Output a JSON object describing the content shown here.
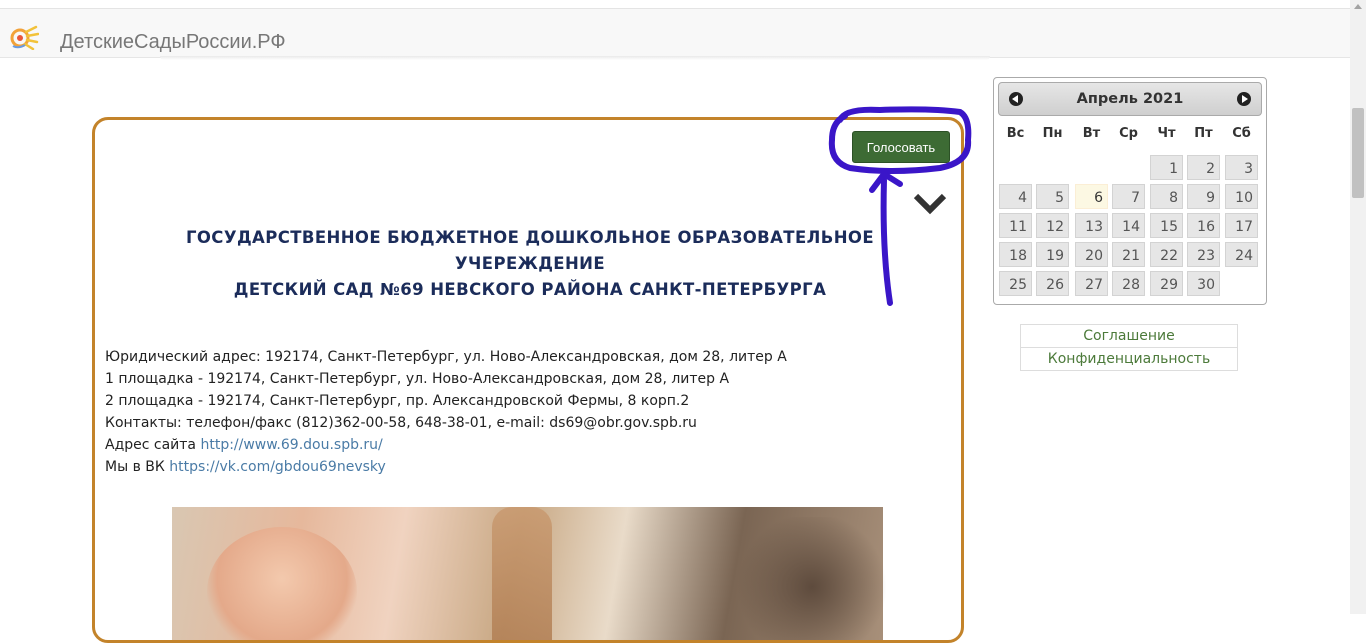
{
  "site": {
    "brand": "ДетскиеСадыРоссии.РФ",
    "logo_icon": "sun-hand-logo"
  },
  "card": {
    "vote_label": "Голосовать",
    "title_lines": [
      "ГОСУДАРСТВЕННОЕ БЮДЖЕТНОЕ ДОШКОЛЬНОЕ ОБРАЗОВАТЕЛЬНОЕ",
      "УЧЕРЕЖДЕНИЕ",
      "ДЕТСКИЙ САД №69 НЕВСКОГО РАЙОНА САНКТ-ПЕТЕРБУРГА"
    ],
    "info": {
      "legal_address": "Юридический адрес: 192174, Санкт-Петербург, ул. Ново-Александровская, дом 28, литер А",
      "site1": "1 площадка - 192174, Санкт-Петербург, ул. Ново-Александровская, дом 28, литер А",
      "site2": "2 площадка - 192174, Санкт-Петербург, пр. Александровской Фермы, 8 корп.2",
      "contacts": "Контакты: телефон/факс  (812)362-00-58, 648-38-01, e-mail: ds69@obr.gov.spb.ru",
      "website_label": "Адрес сайта ",
      "website_url": "http://www.69.dou.spb.ru/",
      "vk_label": "Мы в ВК ",
      "vk_url": "https://vk.com/gbdou69nevsky"
    }
  },
  "calendar": {
    "month_title": "Апрель 2021",
    "weekdays": [
      "Вс",
      "Пн",
      "Вт",
      "Ср",
      "Чт",
      "Пт",
      "Сб"
    ],
    "first_weekday_index": 4,
    "days_in_month": 30,
    "today": 6
  },
  "footer_links": {
    "agreement": "Соглашение",
    "privacy": "Конфиденциальность"
  },
  "colors": {
    "card_border": "#c3832a",
    "vote_button": "#3d6b34",
    "title": "#1b2c5a",
    "link": "#4a7ba6",
    "annotation": "#3a16c8"
  }
}
